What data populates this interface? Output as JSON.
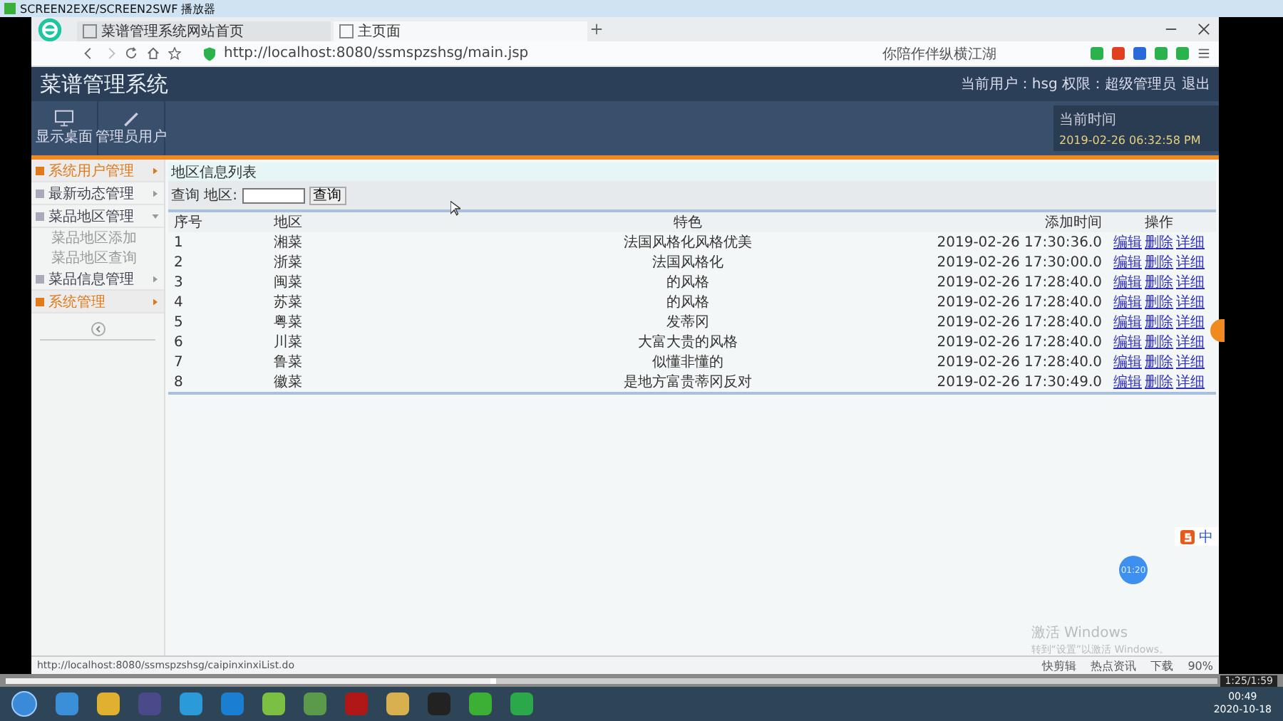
{
  "player": {
    "title": "SCREEN2EXE/SCREEN2SWF 播放器",
    "time": "1:25/1:59",
    "progress": {
      "level": 0.4
    },
    "bubble": "01:20"
  },
  "browser": {
    "tabs": [
      {
        "label": "菜谱管理系统网站首页",
        "selected": false
      },
      {
        "label": "主页面",
        "selected": true
      }
    ],
    "url": "http://localhost:8080/ssmspzshsg/main.jsp",
    "search": "你陪作伴纵横江湖",
    "status_url": "http://localhost:8080/ssmspzshsg/caipinxinxiList.do",
    "status_items": [
      "快剪辑",
      "热点资讯",
      "下载",
      "90%"
    ]
  },
  "app": {
    "title": "菜谱管理系统",
    "user_info": "当前用户：hsg 权限：超级管理员",
    "logout": "退出",
    "toolbar": [
      "显示桌面",
      "管理员用户"
    ],
    "clock": {
      "label": "当前时间",
      "value": "2019-02-26 06:32:58 PM"
    }
  },
  "sidebar": {
    "items": [
      {
        "label": "系统用户管理",
        "selected": true,
        "expanded": false
      },
      {
        "label": "最新动态管理",
        "selected": false,
        "expanded": false
      },
      {
        "label": "菜品地区管理",
        "selected": false,
        "expanded": true,
        "children": [
          {
            "label": "菜品地区添加"
          },
          {
            "label": "菜品地区查询"
          }
        ]
      },
      {
        "label": "菜品信息管理",
        "selected": false,
        "expanded": false
      },
      {
        "label": "系统管理",
        "selected": true,
        "expanded": false
      }
    ]
  },
  "panel": {
    "title": "地区信息列表",
    "search_label": "查询 地区:",
    "search_button": "查询",
    "table": {
      "columns": [
        "序号",
        "地区",
        "特色",
        "添加时间",
        "操作"
      ],
      "rows": [
        {
          "cells": [
            "1",
            "湘菜",
            "法国风格化风格优美",
            "2019-02-26 17:30:36.0"
          ],
          "actions": [
            "编辑",
            "删除",
            "详细"
          ]
        },
        {
          "cells": [
            "2",
            "浙菜",
            "法国风格化",
            "2019-02-26 17:30:00.0"
          ],
          "actions": [
            "编辑",
            "删除",
            "详细"
          ]
        },
        {
          "cells": [
            "3",
            "闽菜",
            "的风格",
            "2019-02-26 17:28:40.0"
          ],
          "actions": [
            "编辑",
            "删除",
            "详细"
          ]
        },
        {
          "cells": [
            "4",
            "苏菜",
            "的风格",
            "2019-02-26 17:28:40.0"
          ],
          "actions": [
            "编辑",
            "删除",
            "详细"
          ]
        },
        {
          "cells": [
            "5",
            "粤菜",
            "发蒂冈",
            "2019-02-26 17:28:40.0"
          ],
          "actions": [
            "编辑",
            "删除",
            "详细"
          ]
        },
        {
          "cells": [
            "6",
            "川菜",
            "大富大贵的风格",
            "2019-02-26 17:28:40.0"
          ],
          "actions": [
            "编辑",
            "删除",
            "详细"
          ]
        },
        {
          "cells": [
            "7",
            "鲁菜",
            "似懂非懂的",
            "2019-02-26 17:28:40.0"
          ],
          "actions": [
            "编辑",
            "删除",
            "详细"
          ]
        },
        {
          "cells": [
            "8",
            "徽菜",
            "是地方富贵蒂冈反对",
            "2019-02-26 17:30:49.0"
          ],
          "actions": [
            "编辑",
            "删除",
            "详细"
          ]
        }
      ]
    }
  },
  "ime": {
    "label": "中"
  },
  "os_notice": {
    "title": "激活 Windows",
    "text": "转到“设置”以激活 Windows。"
  },
  "taskbar": {
    "time": "00:49",
    "date": "2020-10-18"
  }
}
